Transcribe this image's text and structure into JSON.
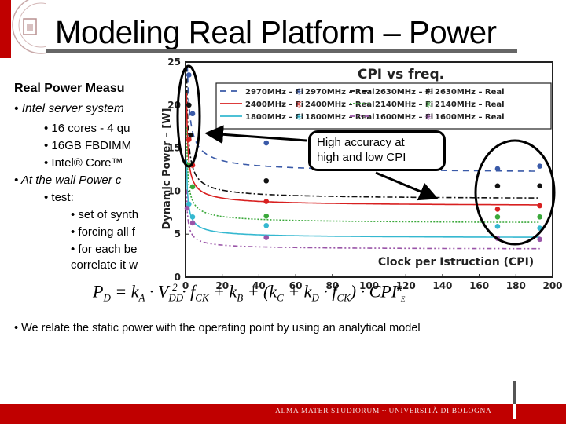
{
  "slide": {
    "title": "Modeling Real Platform – Power",
    "heading": "Real Power Measu",
    "bullets": [
      "•  Intel server system",
      "• 16 cores - 4 qu",
      "• 16GB FBDIMM",
      "•  Intel® Core™",
      "• At the wall Power c",
      "•  test:",
      "• set of synth",
      "• forcing all f",
      "• for each be",
      "correlate it w"
    ],
    "callout": [
      "High accuracy at",
      "high and low CPI"
    ],
    "bottom_bullet": "• We relate the static power with the operating point by using an analytical model",
    "footer": "ALMA MATER STUDIORUM ~ UNIVERSITÀ DI BOLOGNA",
    "formula": {
      "lhs": "P",
      "lhs_sub": "D",
      "parts": [
        "= k",
        "A",
        " · V",
        "DD",
        "2",
        " · f",
        "CK",
        " + k",
        "B",
        " + (k",
        "C",
        " + k",
        "D",
        " · f",
        "CK",
        ") · CPI",
        "k",
        "E"
      ]
    },
    "colors": {
      "brand_red": "#c00000"
    }
  },
  "chart_data": {
    "type": "line",
    "title": "CPI vs freq.",
    "xlabel": "Clock per Istruction (CPI)",
    "ylabel": "Dynamic Power – [W]",
    "xlim": [
      0,
      200
    ],
    "ylim": [
      0,
      25
    ],
    "xticks": [
      0,
      20,
      40,
      60,
      80,
      100,
      120,
      140,
      160,
      180,
      200
    ],
    "yticks": [
      0,
      5,
      10,
      15,
      20,
      25
    ],
    "legend_position": "top",
    "legend": [
      "2970MHz – Fi",
      "2970MHz – Real",
      "2630MHz – Fi",
      "2630MHz – Real",
      "2400MHz – Fi",
      "2400MHz – Real",
      "2140MHz – Fi",
      "2140MHz – Real",
      "1800MHz – Fi",
      "1800MHz – Real",
      "1600MHz – Fi",
      "1600MHz – Real"
    ],
    "series": [
      {
        "name": "2970MHz",
        "color": "#3a5aa8",
        "dash": "8,6",
        "fit": {
          "a": 12.6,
          "b": 12.0,
          "e": 0.7
        },
        "real": [
          [
            1,
            23.5
          ],
          [
            3,
            19.0
          ],
          [
            44,
            15.6
          ],
          [
            170,
            12.6
          ],
          [
            193,
            12.9
          ]
        ]
      },
      {
        "name": "2630MHz",
        "color": "#111111",
        "dash": "7,3,2,3",
        "fit": {
          "a": 10.5,
          "b": 9.0,
          "e": 0.75
        },
        "real": [
          [
            1,
            20.0
          ],
          [
            2,
            16.5
          ],
          [
            44,
            11.2
          ],
          [
            170,
            10.6
          ],
          [
            193,
            10.6
          ]
        ]
      },
      {
        "name": "2400MHz",
        "color": "#d82020",
        "dash": "",
        "fit": {
          "a": 8.1,
          "b": 8.2,
          "e": 0.7
        },
        "real": [
          [
            1,
            16.0
          ],
          [
            3,
            13.0
          ],
          [
            44,
            8.8
          ],
          [
            170,
            7.9
          ],
          [
            193,
            8.3
          ]
        ]
      },
      {
        "name": "2140MHz",
        "color": "#3aa83a",
        "dash": "2,2",
        "fit": {
          "a": 6.9,
          "b": 6.2,
          "e": 0.7
        },
        "real": [
          [
            1,
            13.0
          ],
          [
            3,
            10.5
          ],
          [
            44,
            7.1
          ],
          [
            170,
            7.0
          ],
          [
            193,
            7.0
          ]
        ]
      },
      {
        "name": "1800MHz",
        "color": "#35b8d0",
        "dash": "",
        "fit": {
          "a": 5.6,
          "b": 4.5,
          "e": 0.7
        },
        "real": [
          [
            1,
            8.5
          ],
          [
            3,
            7.0
          ],
          [
            44,
            6.0
          ],
          [
            170,
            5.9
          ],
          [
            193,
            5.7
          ]
        ]
      },
      {
        "name": "1600MHz",
        "color": "#9a55a8",
        "dash": "6,3,2,3,2,3",
        "fit": {
          "a": 4.3,
          "b": 3.2,
          "e": 0.7
        },
        "real": [
          [
            0,
            8.0
          ],
          [
            3,
            6.3
          ],
          [
            44,
            4.6
          ],
          [
            170,
            4.5
          ],
          [
            193,
            4.4
          ]
        ]
      }
    ]
  }
}
